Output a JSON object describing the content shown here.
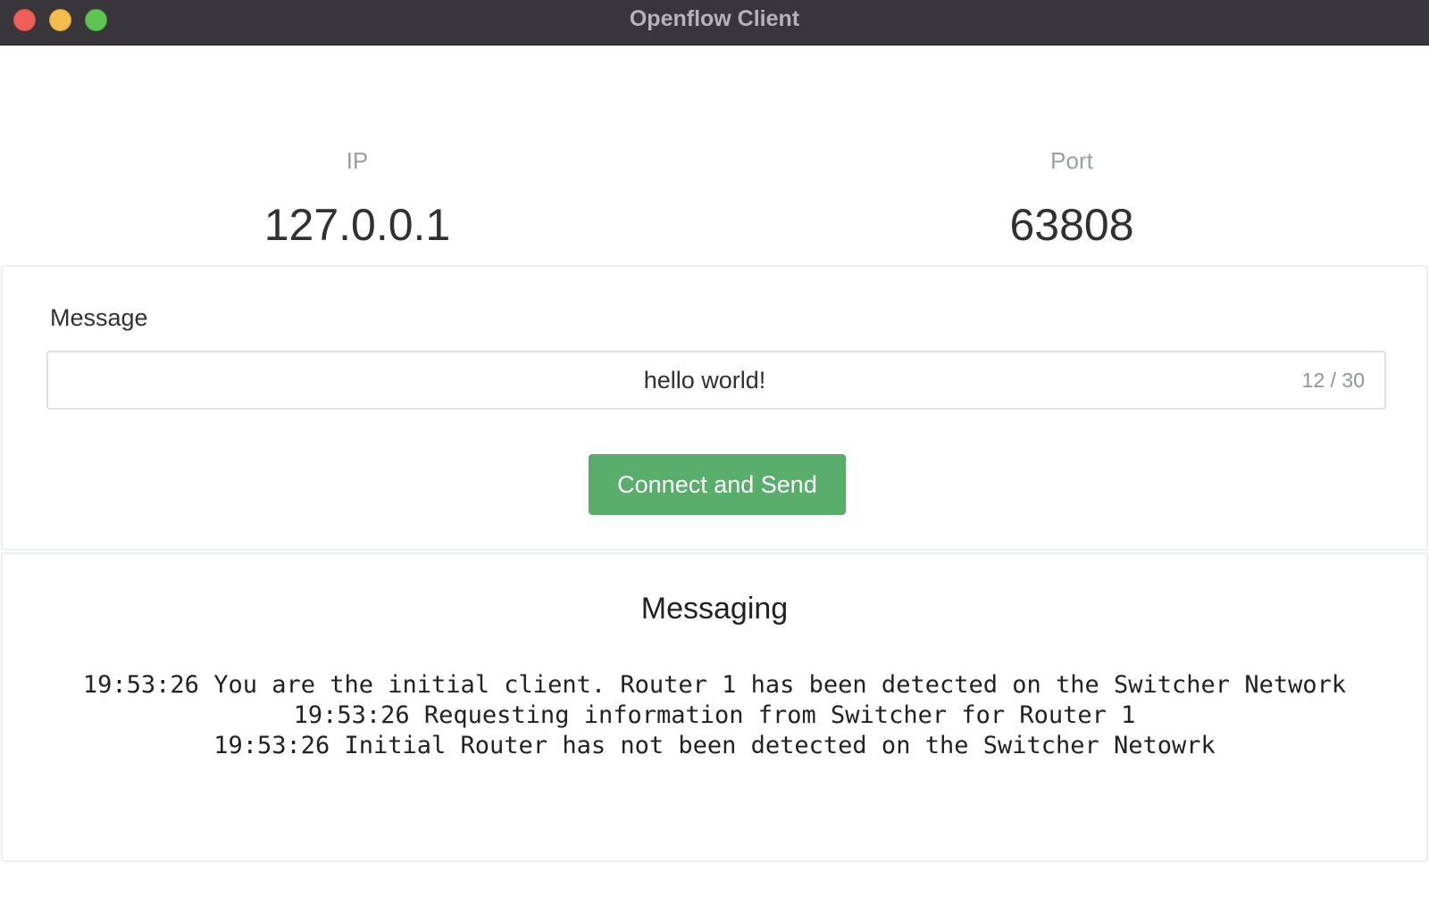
{
  "window": {
    "title": "Openflow Client"
  },
  "connection": {
    "ip_label": "IP",
    "ip_value": "127.0.0.1",
    "port_label": "Port",
    "port_value": "63808"
  },
  "message_form": {
    "label": "Message",
    "input_value": "hello world!",
    "char_count": "12 / 30",
    "send_button_label": "Connect and Send"
  },
  "messaging": {
    "title": "Messaging",
    "log": [
      "19:53:26 You are the initial client. Router 1 has been detected on the Switcher Network",
      "19:53:26 Requesting information from Switcher for Router 1",
      "19:53:26 Initial Router has not been detected on the Switcher Netowrk"
    ]
  },
  "colors": {
    "titlebar": "#38363a",
    "close": "#ee5f57",
    "minimize": "#f4bd4f",
    "zoom": "#5fc454",
    "primary_button": "#5aae6b"
  }
}
